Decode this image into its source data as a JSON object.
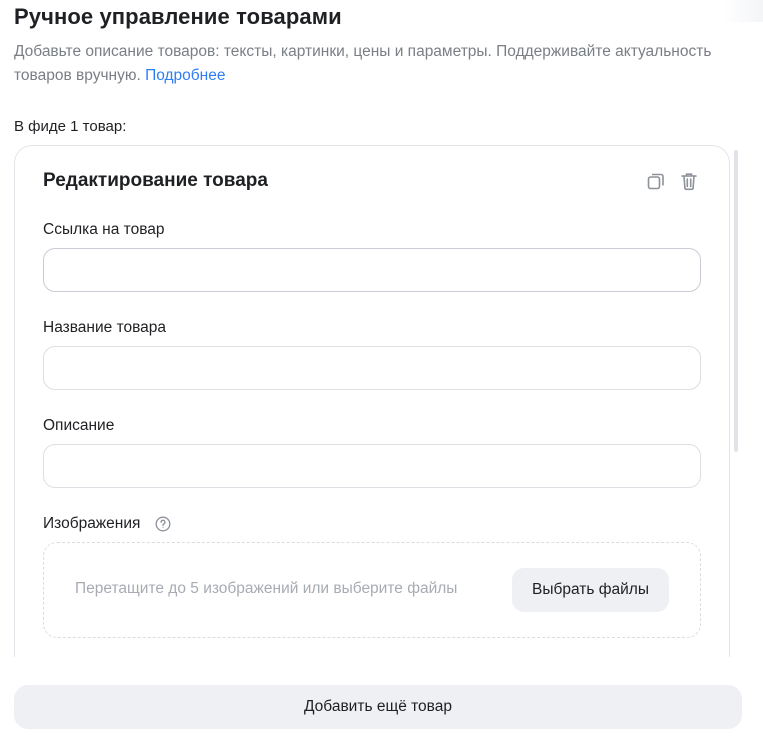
{
  "header": {
    "title": "Ручное управление товарами",
    "description": "Добавьте описание товаров: тексты, картинки, цены и параметры. Поддерживайте актуальность товаров вручную.",
    "more_link": "Подробнее"
  },
  "feed": {
    "count_label": "В фиде 1 товар:"
  },
  "product_card": {
    "title": "Редактирование товара",
    "copy_icon": "copy-icon",
    "delete_icon": "trash-icon",
    "fields": {
      "link": {
        "label": "Ссылка на товар",
        "value": "",
        "placeholder": ""
      },
      "name": {
        "label": "Название товара",
        "value": "",
        "placeholder": ""
      },
      "description": {
        "label": "Описание",
        "value": "",
        "placeholder": ""
      }
    },
    "images": {
      "label": "Изображения",
      "help_icon": "question-circle-icon",
      "drop_hint": "Перетащите до 5 изображений или выберите файлы",
      "choose_button": "Выбрать файлы"
    }
  },
  "footer": {
    "add_button": "Добавить ещё товар"
  },
  "colors": {
    "link": "#2f7df5",
    "muted_text": "#7a7e85",
    "button_bg": "#eef0f4",
    "border": "#dcdfe4"
  }
}
